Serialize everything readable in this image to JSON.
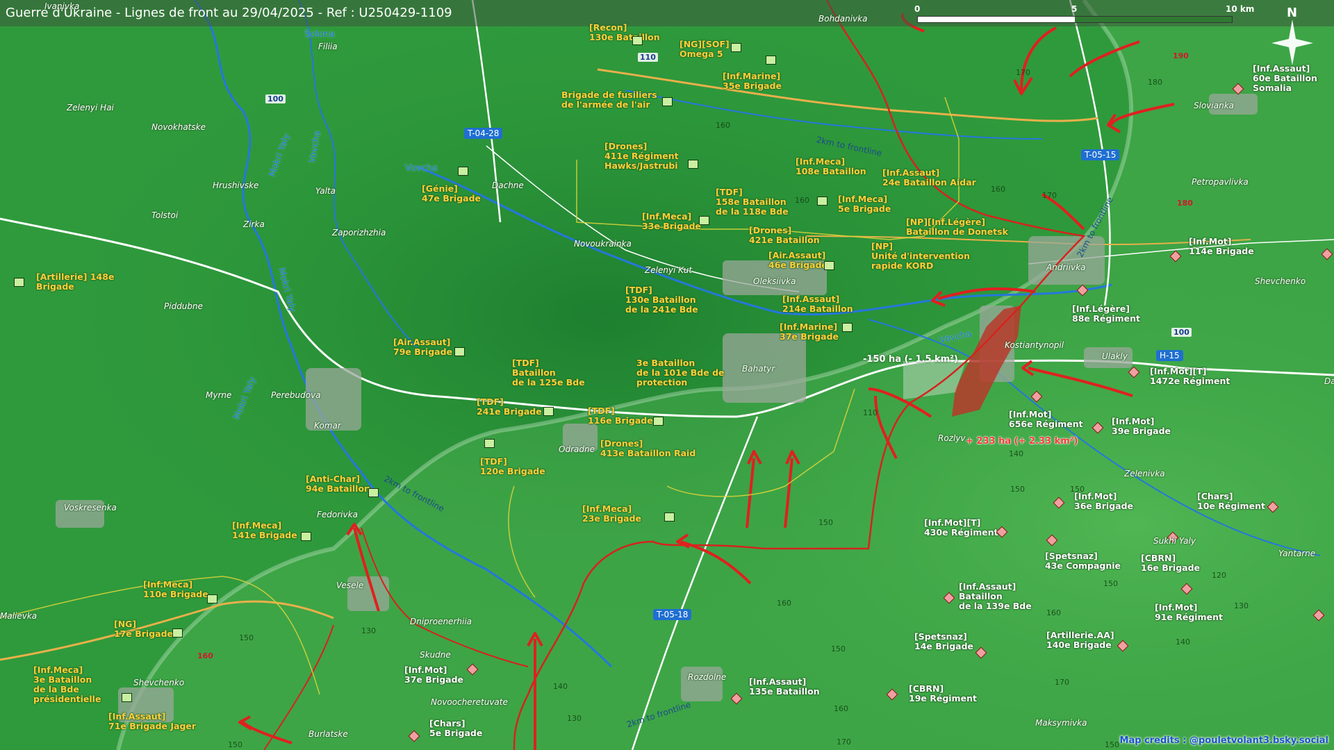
{
  "title": "Guerre d'Ukraine - Lignes de front au 29/04/2025 - Ref : U250429-1109",
  "scale": {
    "labels": [
      "0",
      "5",
      "10 km"
    ]
  },
  "north_label": "N",
  "credits": "Map credits : @pouletvolant3.bsky.social",
  "colors": {
    "ua_units": "#ffcf3a",
    "ru_units": "#ffffff",
    "ru_arrows": "#e0201f",
    "front_zone": "#b73a2a",
    "terrain": "#2f9a3c"
  },
  "ua_units": [
    {
      "id": "recon130",
      "text": "[Recon]\n130e Bataillon"
    },
    {
      "id": "omega5",
      "text": "[NG][SOF]\nOmega 5"
    },
    {
      "id": "marine35",
      "text": "[Inf.Marine]\n35e Brigade"
    },
    {
      "id": "fusiliers",
      "text": "Brigade de fusiliers\nde l'armée de l'air"
    },
    {
      "id": "drones411",
      "text": "[Drones]\n411e Régiment\nHawks/Jastrubi"
    },
    {
      "id": "meca108",
      "text": "[Inf.Meca]\n108e Bataillon"
    },
    {
      "id": "assaut24",
      "text": "[Inf.Assaut]\n24e Bataillon Aidar"
    },
    {
      "id": "genie47",
      "text": "[Génie]\n47e Brigade"
    },
    {
      "id": "tdf158",
      "text": "[TDF]\n158e Bataillon\nde la 118e Bde"
    },
    {
      "id": "meca5",
      "text": "[Inf.Meca]\n5e Brigade"
    },
    {
      "id": "meca33",
      "text": "[Inf.Meca]\n33e Brigade"
    },
    {
      "id": "donetsk",
      "text": "[NP][Inf.Légère]\nBataillon de Donetsk"
    },
    {
      "id": "drones421",
      "text": "[Drones]\n421e Bataillon"
    },
    {
      "id": "kord",
      "text": "[NP]\nUnité d'intervention\nrapide KORD"
    },
    {
      "id": "airassaut46",
      "text": "[Air.Assaut]\n46e Brigade"
    },
    {
      "id": "artillerie148",
      "text": "[Artillerie] 148e\nBrigade"
    },
    {
      "id": "tdf130",
      "text": "[TDF]\n130e Bataillon\nde la 241e Bde"
    },
    {
      "id": "assaut214",
      "text": "[Inf.Assaut]\n214e Bataillon"
    },
    {
      "id": "marine37",
      "text": "[Inf.Marine]\n37e Brigade"
    },
    {
      "id": "airassaut79",
      "text": "[Air.Assaut]\n79e Brigade"
    },
    {
      "id": "tdf125",
      "text": "[TDF]\nBataillon\nde la 125e Bde"
    },
    {
      "id": "bat3",
      "text": "3e Bataillon\nde la 101e Bde de\nprotection"
    },
    {
      "id": "tdf241",
      "text": "[TDF]\n241e Brigade"
    },
    {
      "id": "tdf116",
      "text": "[TDF]\n116e Brigade"
    },
    {
      "id": "drones413",
      "text": "[Drones]\n413e Bataillon Raid"
    },
    {
      "id": "tdf120",
      "text": "[TDF]\n120e Brigade"
    },
    {
      "id": "antichar94",
      "text": "[Anti-Char]\n94e Bataillon"
    },
    {
      "id": "meca23",
      "text": "[Inf.Meca]\n23e Brigade"
    },
    {
      "id": "meca141",
      "text": "[Inf.Meca]\n141e Brigade"
    },
    {
      "id": "meca110",
      "text": "[Inf.Meca]\n110e Brigade"
    },
    {
      "id": "ng17",
      "text": "[NG]\n17e Brigade"
    },
    {
      "id": "meca3",
      "text": "[Inf.Meca]\n3e Bataillon\nde la Bde\nprésidentielle"
    },
    {
      "id": "assaut71",
      "text": "[Inf.Assaut]\n71e Brigade Jager"
    }
  ],
  "ru_units": [
    {
      "id": "assaut60",
      "text": "[Inf.Assaut]\n60e Bataillon\nSomalia"
    },
    {
      "id": "mot114",
      "text": "[Inf.Mot]\n114e Brigade"
    },
    {
      "id": "legere88",
      "text": "[Inf.Légère]\n88e Régiment"
    },
    {
      "id": "mot1472",
      "text": "[Inf.Mot][T]\n1472e Régiment"
    },
    {
      "id": "mot656",
      "text": "[Inf.Mot]\n656e Régiment"
    },
    {
      "id": "mot39",
      "text": "[Inf.Mot]\n39e Brigade"
    },
    {
      "id": "mot36",
      "text": "[Inf.Mot]\n36e Brigade"
    },
    {
      "id": "chars10",
      "text": "[Chars]\n10e Régiment"
    },
    {
      "id": "mot430",
      "text": "[Inf.Mot][T]\n430e Régiment"
    },
    {
      "id": "spetsnaz43",
      "text": "[Spetsnaz]\n43e Compagnie"
    },
    {
      "id": "cbrn16",
      "text": "[CBRN]\n16e Brigade"
    },
    {
      "id": "assaut139",
      "text": "[Inf.Assaut]\nBataillon\nde la 139e Bde"
    },
    {
      "id": "mot91",
      "text": "[Inf.Mot]\n91e Régiment"
    },
    {
      "id": "spetsnaz14",
      "text": "[Spetsnaz]\n14e Brigade"
    },
    {
      "id": "artaa140",
      "text": "[Artillerie.AA]\n140e Brigade"
    },
    {
      "id": "mot37",
      "text": "[Inf.Mot]\n37e Brigade"
    },
    {
      "id": "assaut135",
      "text": "[Inf.Assaut]\n135e Bataillon"
    },
    {
      "id": "cbrn19",
      "text": "[CBRN]\n19e Régiment"
    },
    {
      "id": "chars5",
      "text": "[Chars]\n5e Brigade"
    }
  ],
  "places": [
    {
      "id": "bohdanivka",
      "text": "Bohdanivka"
    },
    {
      "id": "filiia",
      "text": "Filiia"
    },
    {
      "id": "zelenyi-hai",
      "text": "Zelenyi Hai"
    },
    {
      "id": "novokhatske",
      "text": "Novokhatske"
    },
    {
      "id": "slovianka",
      "text": "Slovianka"
    },
    {
      "id": "dachne",
      "text": "Dachne"
    },
    {
      "id": "hrushivske",
      "text": "Hrushivske"
    },
    {
      "id": "yalta",
      "text": "Yalta"
    },
    {
      "id": "petropavlivka",
      "text": "Petropavlivka"
    },
    {
      "id": "tolstoi",
      "text": "Tolstoi"
    },
    {
      "id": "zirka",
      "text": "Zirka"
    },
    {
      "id": "zaporizhzhia",
      "text": "Zaporizhzhia"
    },
    {
      "id": "novoukrainka",
      "text": "Novoukrainka"
    },
    {
      "id": "andriivka",
      "text": "Andriivka"
    },
    {
      "id": "zelenyi-kut",
      "text": "Zelenyi Kut"
    },
    {
      "id": "oleksiivka",
      "text": "Oleksiivka"
    },
    {
      "id": "shevchenko-e",
      "text": "Shevchenko"
    },
    {
      "id": "piddubne",
      "text": "Piddubne"
    },
    {
      "id": "kostiantynopil",
      "text": "Kostiantynopil"
    },
    {
      "id": "ulakly",
      "text": "Ulakly"
    },
    {
      "id": "bahatyr",
      "text": "Bahatyr"
    },
    {
      "id": "da",
      "text": "Da"
    },
    {
      "id": "myrne",
      "text": "Myrne"
    },
    {
      "id": "perebudova",
      "text": "Perebudova"
    },
    {
      "id": "komar",
      "text": "Komar"
    },
    {
      "id": "rozlyv",
      "text": "Rozlyv"
    },
    {
      "id": "odradne",
      "text": "Odradne"
    },
    {
      "id": "zelenivka",
      "text": "Zelenivka"
    },
    {
      "id": "voskresenka",
      "text": "Voskresenka"
    },
    {
      "id": "fedorivka",
      "text": "Fedorivka"
    },
    {
      "id": "sukhi-yaly",
      "text": "Sukhi Yaly"
    },
    {
      "id": "yantarne",
      "text": "Yantarne"
    },
    {
      "id": "vesele",
      "text": "Vesele"
    },
    {
      "id": "malievka",
      "text": "Malievka"
    },
    {
      "id": "dniproenerhiia",
      "text": "Dniproenerhiia"
    },
    {
      "id": "skudne",
      "text": "Skudne"
    },
    {
      "id": "shevchenko-w",
      "text": "Shevchenko"
    },
    {
      "id": "rozdolne",
      "text": "Rozdolne"
    },
    {
      "id": "novoocheretuvate",
      "text": "Novoocheretuvate"
    },
    {
      "id": "burlatske",
      "text": "Burlatske"
    },
    {
      "id": "maksymivka",
      "text": "Maksymivka"
    },
    {
      "id": "ivanivka",
      "text": "Ivanivka"
    }
  ],
  "rivers": [
    {
      "id": "solona",
      "text": "Solona"
    },
    {
      "id": "vovcha-w",
      "text": "Vovcha"
    },
    {
      "id": "vovcha-e",
      "text": "Vovcha"
    },
    {
      "id": "mokri-yaly-1",
      "text": "Mokri Yaly"
    },
    {
      "id": "vovcha-v",
      "text": "Vovcha"
    },
    {
      "id": "mokri-yaly-2",
      "text": "Mokri Yaly"
    },
    {
      "id": "mokri-yaly-3",
      "text": "Mokri Yaly"
    }
  ],
  "roads": [
    {
      "id": "t0428",
      "text": "T-04-28"
    },
    {
      "id": "t0515",
      "text": "T-05-15"
    },
    {
      "id": "h15",
      "text": "H-15"
    },
    {
      "id": "t0518",
      "text": "T-05-18"
    }
  ],
  "road_numbers": [
    {
      "id": "r110",
      "text": "110"
    },
    {
      "id": "r100w",
      "text": "100"
    },
    {
      "id": "r100e",
      "text": "100"
    }
  ],
  "elevations": [
    {
      "id": "e180a",
      "text": "180"
    },
    {
      "id": "e170a",
      "text": "170"
    },
    {
      "id": "e160a",
      "text": "160"
    },
    {
      "id": "e160b",
      "text": "160"
    },
    {
      "id": "e170b",
      "text": "170"
    },
    {
      "id": "e160c",
      "text": "160"
    },
    {
      "id": "e110",
      "text": "110"
    },
    {
      "id": "e140a",
      "text": "140"
    },
    {
      "id": "e150a",
      "text": "150"
    },
    {
      "id": "e150b",
      "text": "150"
    },
    {
      "id": "e120",
      "text": "120"
    },
    {
      "id": "e150c",
      "text": "150"
    },
    {
      "id": "e130a",
      "text": "130"
    },
    {
      "id": "e160d",
      "text": "160"
    },
    {
      "id": "e160e",
      "text": "160"
    },
    {
      "id": "e150d",
      "text": "150"
    },
    {
      "id": "e140b",
      "text": "140"
    },
    {
      "id": "e150e",
      "text": "150"
    },
    {
      "id": "e130b",
      "text": "130"
    },
    {
      "id": "e150f",
      "text": "150"
    },
    {
      "id": "e140c",
      "text": "140"
    },
    {
      "id": "e130c",
      "text": "130"
    },
    {
      "id": "e160f",
      "text": "160"
    },
    {
      "id": "e170c",
      "text": "170"
    },
    {
      "id": "e170d",
      "text": "170"
    },
    {
      "id": "e150g",
      "text": "150"
    },
    {
      "id": "e150h",
      "text": "150"
    }
  ],
  "elevations_red": [
    {
      "id": "r190",
      "text": "190"
    },
    {
      "id": "r180",
      "text": "180"
    },
    {
      "id": "r160",
      "text": "160"
    }
  ],
  "area_changes": [
    {
      "id": "loss",
      "text": "-150 ha (- 1.5 km²)"
    },
    {
      "id": "gain",
      "text": "+ 233 ha (+ 2.33 km²)"
    }
  ],
  "frontline_labels": [
    {
      "id": "fl1",
      "text": "2km to frontline"
    },
    {
      "id": "fl2",
      "text": "2km to frontline"
    },
    {
      "id": "fl3",
      "text": "2km to frontline"
    },
    {
      "id": "fl4",
      "text": "2km to frontline"
    }
  ]
}
